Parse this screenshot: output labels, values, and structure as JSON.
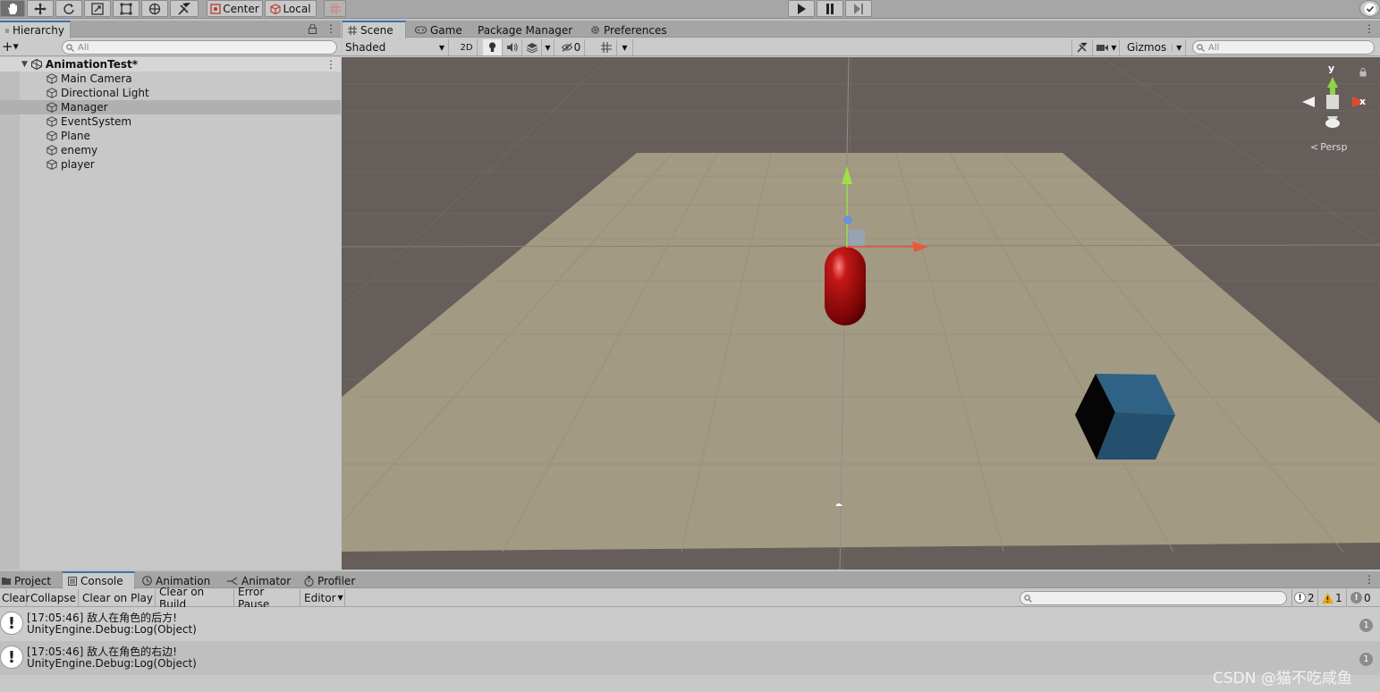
{
  "toolbar": {
    "pivot_label": "Center",
    "space_label": "Local"
  },
  "hierarchy": {
    "tab_label": "Hierarchy",
    "add_label": "+",
    "search_placeholder": "All",
    "scene_name": "AnimationTest*",
    "items": [
      {
        "label": "Main Camera"
      },
      {
        "label": "Directional Light"
      },
      {
        "label": "Manager"
      },
      {
        "label": "EventSystem"
      },
      {
        "label": "Plane"
      },
      {
        "label": "enemy"
      },
      {
        "label": "player"
      }
    ],
    "selected_index": 2
  },
  "scene_tabs": {
    "scene": "Scene",
    "game": "Game",
    "package_manager": "Package Manager",
    "preferences": "Preferences"
  },
  "scene_toolbar": {
    "shading_mode": "Shaded",
    "mode_2d": "2D",
    "hidden_count": "0",
    "gizmos_label": "Gizmos",
    "search_placeholder": "All"
  },
  "scene_view": {
    "gizmo_y": "y",
    "gizmo_x": "x",
    "projection_label": "Persp",
    "colors": {
      "sky": "#665e5a",
      "plane": "#a39a84",
      "capsule": "#b01212",
      "cube_front": "#2b5a7a",
      "cube_top": "#2f6285",
      "cube_side": "#050505"
    }
  },
  "bottom_tabs": {
    "project": "Project",
    "console": "Console",
    "animation": "Animation",
    "animator": "Animator",
    "profiler": "Profiler"
  },
  "console_toolbar": {
    "clear": "Clear",
    "collapse": "Collapse",
    "clear_on_play": "Clear on Play",
    "clear_on_build": "Clear on Build",
    "error_pause": "Error Pause",
    "editor": "Editor",
    "log_count": "2",
    "warning_count": "1",
    "error_count": "0"
  },
  "console_logs": [
    {
      "line1": "[17:05:46] 敌人在角色的后方!",
      "line2": "UnityEngine.Debug:Log(Object)",
      "count": "1"
    },
    {
      "line1": "[17:05:46] 敌人在角色的右边!",
      "line2": "UnityEngine.Debug:Log(Object)",
      "count": "1"
    }
  ],
  "watermark": "CSDN @猫不吃咸鱼"
}
